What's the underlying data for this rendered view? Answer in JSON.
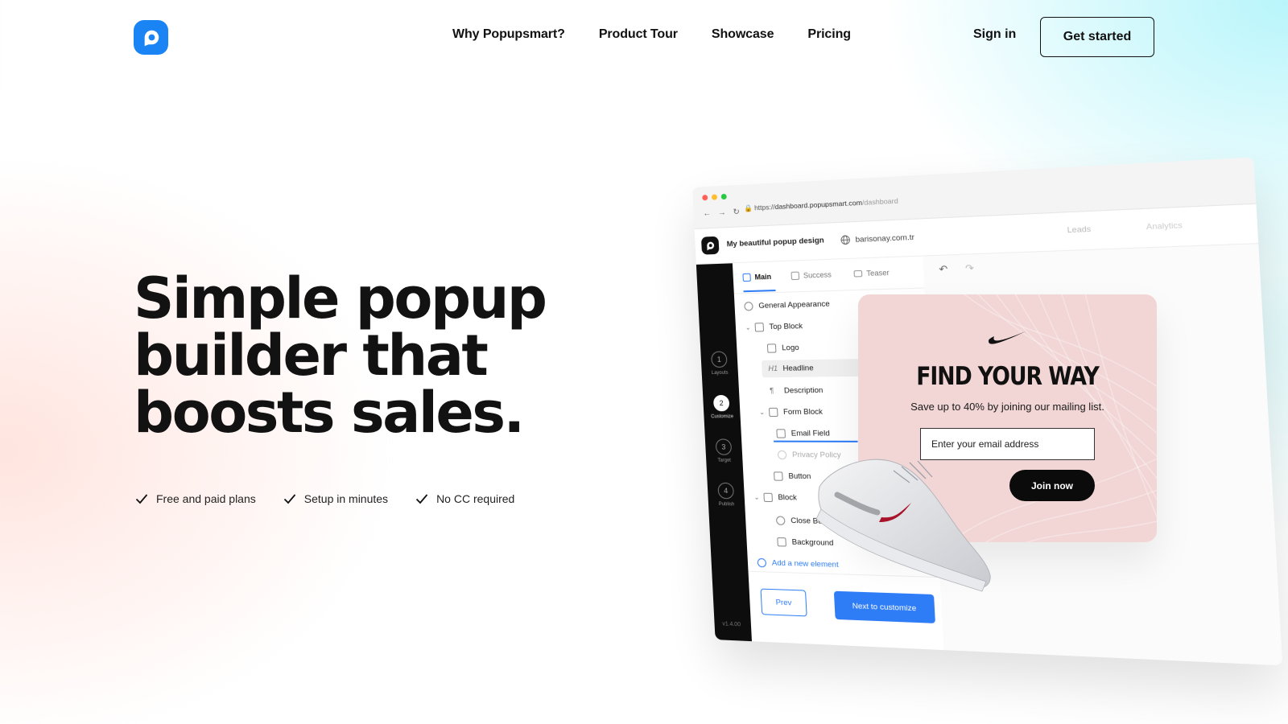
{
  "nav": {
    "links": [
      "Why Popupsmart?",
      "Product Tour",
      "Showcase",
      "Pricing"
    ],
    "signin": "Sign in",
    "cta": "Get started"
  },
  "hero": {
    "title_lines": [
      "Simple popup",
      "builder that",
      "boosts sales."
    ],
    "features": [
      "Free and paid plans",
      "Setup in minutes",
      "No CC required"
    ]
  },
  "mockup": {
    "url_prefix": "https://",
    "url_domain": "dashboard.popupsmart.com",
    "url_path": "/dashboard",
    "popup_name": "My beautiful popup design",
    "site": "barisonay.com.tr",
    "top_tabs": [
      "Leads",
      "Analytics"
    ],
    "editor_tabs": [
      "Main",
      "Success",
      "Teaser"
    ],
    "steps": [
      {
        "num": "1",
        "label": "Layouts"
      },
      {
        "num": "2",
        "label": "Customize"
      },
      {
        "num": "3",
        "label": "Target"
      },
      {
        "num": "4",
        "label": "Publish"
      }
    ],
    "tree": [
      "General Appearance",
      "Top Block",
      "Logo",
      "Headline",
      "Description",
      "Form Block",
      "Email Field",
      "Privacy Policy",
      "Button",
      "Block",
      "Close Button",
      "Background",
      "Add a new element"
    ],
    "prev": "Prev",
    "next": "Next to customize",
    "version": "v1.4.00"
  },
  "popup": {
    "title": "FIND YOUR WAY",
    "subtitle": "Save up to 40% by joining our mailing list.",
    "input_placeholder": "Enter your email address",
    "button": "Join now",
    "bg_color": "#f2d6d6"
  },
  "colors": {
    "brand": "#2f7df6",
    "text": "#121212"
  }
}
